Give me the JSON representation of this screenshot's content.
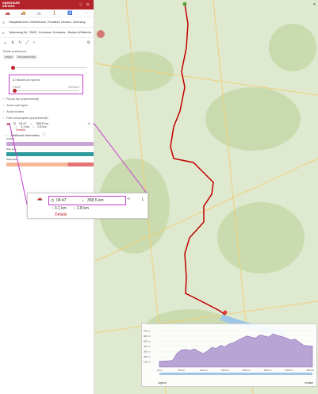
{
  "app": {
    "logo_line1": "openroute",
    "logo_line2": "service"
  },
  "places": [
    {
      "letter": "S",
      "value": "Hauptbahnhof, Goethehaus, Frankfurt, Hessen, Germany"
    },
    {
      "letter": "E",
      "value": "Talsenweg 4b, 78467, Konstanz, Konstanz , Baden-Württemberg, Germany"
    }
  ],
  "route_pref": {
    "label": "Route preference",
    "chips": [
      "weight",
      "Recommended"
    ]
  },
  "max_speed": {
    "label": "Maximum speed",
    "min": "0 km/h",
    "max": "120 km/h"
  },
  "options": [
    "Round trip (experimental)",
    "Avoid road types",
    "Avoid borders",
    "Fuel consumption (experimental)"
  ],
  "summary": {
    "time": "04:47",
    "distance": "358.5 km",
    "ascent": "3.1 km",
    "descent": "2.8 km",
    "details": "Details"
  },
  "additional_info": {
    "title": "Additional information",
    "bars": [
      "Surface",
      "Way type",
      "Steepness"
    ]
  },
  "legend": {
    "label": "Legend",
    "surface": "surface"
  },
  "colors": {
    "brand": "#b5232a",
    "highlight": "#c43ecf",
    "route": "#c00000"
  },
  "chart_data": {
    "type": "area",
    "title": "",
    "ylabel": "",
    "xlabel": "",
    "x_ticks": [
      "0 km",
      "50 km",
      "100 km",
      "150 km",
      "200 km",
      "250 km",
      "300 km",
      "350 km"
    ],
    "y_ticks": [
      "700 m",
      "600 m",
      "500 m",
      "400 m",
      "300 m",
      "200 m",
      "100 m"
    ],
    "xlim": [
      0,
      358.5
    ],
    "ylim": [
      0,
      750
    ],
    "series": [
      {
        "values": [
          110,
          115,
          120,
          130,
          260,
          330,
          340,
          320,
          350,
          300,
          260,
          310,
          380,
          360,
          420,
          390,
          450,
          470,
          520,
          560,
          600,
          580,
          560,
          620,
          600,
          580,
          640,
          610,
          590,
          560,
          520,
          540,
          480,
          420,
          410,
          405
        ]
      }
    ]
  }
}
